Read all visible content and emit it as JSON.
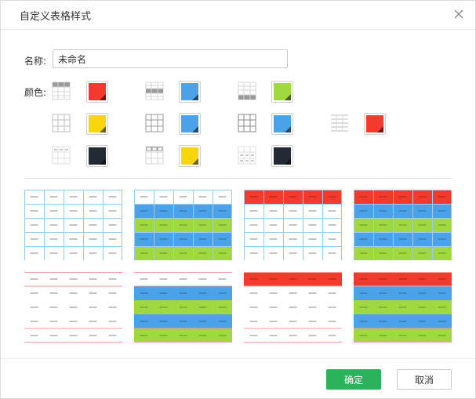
{
  "dialog": {
    "title": "自定义表格样式",
    "name_label": "名称:",
    "name_value": "未命名",
    "color_label": "颜色:",
    "ok_label": "确定",
    "cancel_label": "取消"
  },
  "colors": {
    "red": "#f43a2c",
    "blue": "#4aa3e8",
    "green": "#9fd93f",
    "yellow": "#f7d70b",
    "dark": "#242a33",
    "grid_gray": "#c8c8c8",
    "accent_green": "#2bb25d"
  },
  "color_options": [
    {
      "pattern": "header-bar-grid",
      "swatch": "#f43a2c"
    },
    {
      "pattern": "middle-band-grid",
      "swatch": "#4aa3e8"
    },
    {
      "pattern": "footer-bar-grid",
      "swatch": "#9fd93f"
    },
    {
      "pattern": "full-grid",
      "swatch": "#f7d70b"
    },
    {
      "pattern": "full-grid",
      "swatch": "#4aa3e8"
    },
    {
      "pattern": "full-grid",
      "swatch": "#4aa3e8"
    },
    {
      "pattern": "horizontal-lines",
      "swatch": "#f43a2c"
    },
    {
      "pattern": "dashed-grid",
      "swatch": "#242a33"
    },
    {
      "pattern": "dashed-header-grid",
      "swatch": "#f7d70b"
    },
    {
      "pattern": "dashed-rows-grid",
      "swatch": "#242a33"
    }
  ],
  "previews": [
    {
      "style": "plain-grid",
      "header": "none",
      "body": "plain",
      "line": "#9ccbee"
    },
    {
      "style": "grid-alternating",
      "header": "none",
      "body": "alternating",
      "line": "#9ccbee"
    },
    {
      "style": "red-header-grid",
      "header": "#f43a2c",
      "body": "plain",
      "line": "#9ccbee"
    },
    {
      "style": "red-header-alternating",
      "header": "#f43a2c",
      "body": "alternating",
      "line": "#9ccbee"
    },
    {
      "style": "lines-only",
      "header": "none",
      "body": "plain",
      "line": "#f0a0a0"
    },
    {
      "style": "lines-alternating",
      "header": "none",
      "body": "alternating",
      "line": "#f0a0a0"
    },
    {
      "style": "red-header-lines",
      "header": "#f43a2c",
      "body": "plain",
      "line": "#f0a0a0"
    },
    {
      "style": "red-header-lines-alternating",
      "header": "#f43a2c",
      "body": "alternating",
      "line": "#f0a0a0"
    }
  ]
}
